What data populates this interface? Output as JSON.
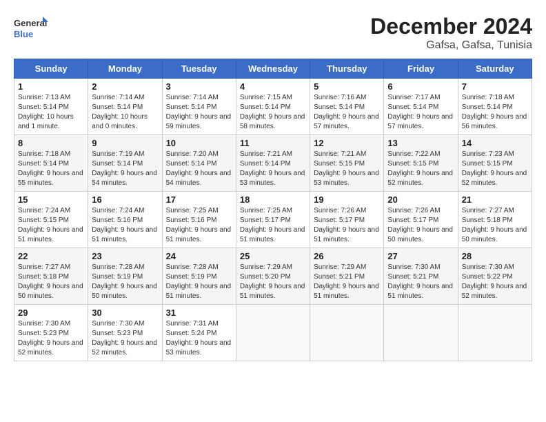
{
  "header": {
    "logo_line1": "General",
    "logo_line2": "Blue",
    "month_year": "December 2024",
    "location": "Gafsa, Gafsa, Tunisia"
  },
  "weekdays": [
    "Sunday",
    "Monday",
    "Tuesday",
    "Wednesday",
    "Thursday",
    "Friday",
    "Saturday"
  ],
  "weeks": [
    [
      {
        "day": "1",
        "sunrise": "Sunrise: 7:13 AM",
        "sunset": "Sunset: 5:14 PM",
        "daylight": "Daylight: 10 hours and 1 minute."
      },
      {
        "day": "2",
        "sunrise": "Sunrise: 7:14 AM",
        "sunset": "Sunset: 5:14 PM",
        "daylight": "Daylight: 10 hours and 0 minutes."
      },
      {
        "day": "3",
        "sunrise": "Sunrise: 7:14 AM",
        "sunset": "Sunset: 5:14 PM",
        "daylight": "Daylight: 9 hours and 59 minutes."
      },
      {
        "day": "4",
        "sunrise": "Sunrise: 7:15 AM",
        "sunset": "Sunset: 5:14 PM",
        "daylight": "Daylight: 9 hours and 58 minutes."
      },
      {
        "day": "5",
        "sunrise": "Sunrise: 7:16 AM",
        "sunset": "Sunset: 5:14 PM",
        "daylight": "Daylight: 9 hours and 57 minutes."
      },
      {
        "day": "6",
        "sunrise": "Sunrise: 7:17 AM",
        "sunset": "Sunset: 5:14 PM",
        "daylight": "Daylight: 9 hours and 57 minutes."
      },
      {
        "day": "7",
        "sunrise": "Sunrise: 7:18 AM",
        "sunset": "Sunset: 5:14 PM",
        "daylight": "Daylight: 9 hours and 56 minutes."
      }
    ],
    [
      {
        "day": "8",
        "sunrise": "Sunrise: 7:18 AM",
        "sunset": "Sunset: 5:14 PM",
        "daylight": "Daylight: 9 hours and 55 minutes."
      },
      {
        "day": "9",
        "sunrise": "Sunrise: 7:19 AM",
        "sunset": "Sunset: 5:14 PM",
        "daylight": "Daylight: 9 hours and 54 minutes."
      },
      {
        "day": "10",
        "sunrise": "Sunrise: 7:20 AM",
        "sunset": "Sunset: 5:14 PM",
        "daylight": "Daylight: 9 hours and 54 minutes."
      },
      {
        "day": "11",
        "sunrise": "Sunrise: 7:21 AM",
        "sunset": "Sunset: 5:14 PM",
        "daylight": "Daylight: 9 hours and 53 minutes."
      },
      {
        "day": "12",
        "sunrise": "Sunrise: 7:21 AM",
        "sunset": "Sunset: 5:15 PM",
        "daylight": "Daylight: 9 hours and 53 minutes."
      },
      {
        "day": "13",
        "sunrise": "Sunrise: 7:22 AM",
        "sunset": "Sunset: 5:15 PM",
        "daylight": "Daylight: 9 hours and 52 minutes."
      },
      {
        "day": "14",
        "sunrise": "Sunrise: 7:23 AM",
        "sunset": "Sunset: 5:15 PM",
        "daylight": "Daylight: 9 hours and 52 minutes."
      }
    ],
    [
      {
        "day": "15",
        "sunrise": "Sunrise: 7:24 AM",
        "sunset": "Sunset: 5:15 PM",
        "daylight": "Daylight: 9 hours and 51 minutes."
      },
      {
        "day": "16",
        "sunrise": "Sunrise: 7:24 AM",
        "sunset": "Sunset: 5:16 PM",
        "daylight": "Daylight: 9 hours and 51 minutes."
      },
      {
        "day": "17",
        "sunrise": "Sunrise: 7:25 AM",
        "sunset": "Sunset: 5:16 PM",
        "daylight": "Daylight: 9 hours and 51 minutes."
      },
      {
        "day": "18",
        "sunrise": "Sunrise: 7:25 AM",
        "sunset": "Sunset: 5:17 PM",
        "daylight": "Daylight: 9 hours and 51 minutes."
      },
      {
        "day": "19",
        "sunrise": "Sunrise: 7:26 AM",
        "sunset": "Sunset: 5:17 PM",
        "daylight": "Daylight: 9 hours and 51 minutes."
      },
      {
        "day": "20",
        "sunrise": "Sunrise: 7:26 AM",
        "sunset": "Sunset: 5:17 PM",
        "daylight": "Daylight: 9 hours and 50 minutes."
      },
      {
        "day": "21",
        "sunrise": "Sunrise: 7:27 AM",
        "sunset": "Sunset: 5:18 PM",
        "daylight": "Daylight: 9 hours and 50 minutes."
      }
    ],
    [
      {
        "day": "22",
        "sunrise": "Sunrise: 7:27 AM",
        "sunset": "Sunset: 5:18 PM",
        "daylight": "Daylight: 9 hours and 50 minutes."
      },
      {
        "day": "23",
        "sunrise": "Sunrise: 7:28 AM",
        "sunset": "Sunset: 5:19 PM",
        "daylight": "Daylight: 9 hours and 50 minutes."
      },
      {
        "day": "24",
        "sunrise": "Sunrise: 7:28 AM",
        "sunset": "Sunset: 5:19 PM",
        "daylight": "Daylight: 9 hours and 51 minutes."
      },
      {
        "day": "25",
        "sunrise": "Sunrise: 7:29 AM",
        "sunset": "Sunset: 5:20 PM",
        "daylight": "Daylight: 9 hours and 51 minutes."
      },
      {
        "day": "26",
        "sunrise": "Sunrise: 7:29 AM",
        "sunset": "Sunset: 5:21 PM",
        "daylight": "Daylight: 9 hours and 51 minutes."
      },
      {
        "day": "27",
        "sunrise": "Sunrise: 7:30 AM",
        "sunset": "Sunset: 5:21 PM",
        "daylight": "Daylight: 9 hours and 51 minutes."
      },
      {
        "day": "28",
        "sunrise": "Sunrise: 7:30 AM",
        "sunset": "Sunset: 5:22 PM",
        "daylight": "Daylight: 9 hours and 52 minutes."
      }
    ],
    [
      {
        "day": "29",
        "sunrise": "Sunrise: 7:30 AM",
        "sunset": "Sunset: 5:23 PM",
        "daylight": "Daylight: 9 hours and 52 minutes."
      },
      {
        "day": "30",
        "sunrise": "Sunrise: 7:30 AM",
        "sunset": "Sunset: 5:23 PM",
        "daylight": "Daylight: 9 hours and 52 minutes."
      },
      {
        "day": "31",
        "sunrise": "Sunrise: 7:31 AM",
        "sunset": "Sunset: 5:24 PM",
        "daylight": "Daylight: 9 hours and 53 minutes."
      },
      null,
      null,
      null,
      null
    ]
  ]
}
